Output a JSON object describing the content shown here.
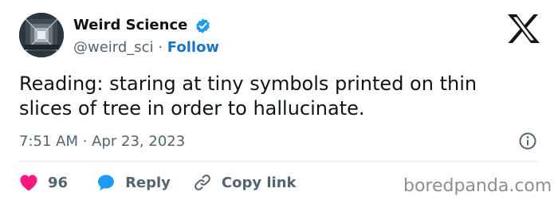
{
  "profile": {
    "name": "Weird Science",
    "handle": "@weird_sci",
    "separator": "·",
    "follow_label": "Follow",
    "verified_icon": "verified-badge-icon",
    "avatar_icon": "avatar-tunnel-image"
  },
  "tweet": {
    "text": "Reading: staring at tiny symbols printed on thin slices of tree in order to hallucinate.",
    "timestamp": "7:51 AM · Apr 23, 2023"
  },
  "actions": {
    "like_count": "96",
    "reply_label": "Reply",
    "copy_link_label": "Copy link"
  },
  "watermark": "boredpanda.com",
  "colors": {
    "verified": "#1d9bf0",
    "follow": "#1d74c4",
    "heart": "#f91880",
    "reply_bubble": "#1d9bf0",
    "secondary_text": "#536471"
  }
}
